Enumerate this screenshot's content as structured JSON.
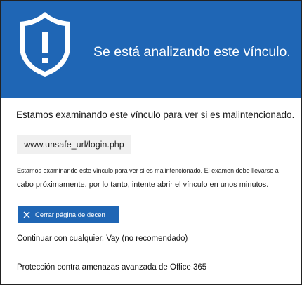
{
  "header": {
    "title": "Se está analizando este vínculo.",
    "icon": "shield-warning-icon",
    "color": "#1f66b5"
  },
  "content": {
    "headline": "Estamos examinando este vínculo para ver si es malintencionado.",
    "url": "www.unsafe_url/login.php",
    "description_line1": "Estamos examinando este vínculo para ver si es malintencionado. El examen debe llevarse a",
    "description_line2": "cabo próximamente. por lo tanto, intente abrir el vínculo en unos minutos."
  },
  "actions": {
    "close_button_label": "Cerrar página de decen",
    "close_icon": "close-icon",
    "continue_link": "Continuar con cualquier. Vay (no recomendado)"
  },
  "footer": {
    "text": "Protección contra amenazas avanzada de Office 365"
  }
}
